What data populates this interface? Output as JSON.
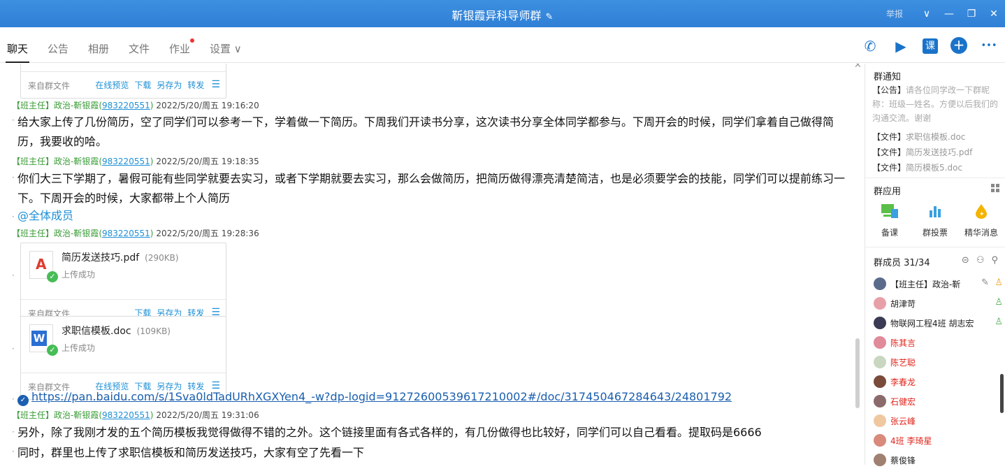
{
  "window": {
    "title": "靳银霞异科导师群",
    "report_label": "举报",
    "edit_glyph": "✎",
    "min_glyph": "—",
    "restore_glyph": "❐",
    "close_glyph": "✕",
    "chevron_glyph": "∨"
  },
  "tabs": [
    "聊天",
    "公告",
    "相册",
    "文件",
    "作业",
    "设置 ∨"
  ],
  "toolbar": {
    "call": "✆",
    "video": "▶",
    "lesson": "课",
    "add": "+",
    "more": "•••"
  },
  "chat": {
    "card0": {
      "source": "来自群文件",
      "preview": "在线预览",
      "download": "下载",
      "save_as": "另存为",
      "forward": "转发"
    },
    "msg1": {
      "role": "【班主任】政治-靳银霞(",
      "qq": "983220551",
      "close": ")",
      "time": "2022/5/20/周五 19:16:20",
      "text": "给大家上传了几份简历，空了同学们可以参考一下，学着做一下简历。下周我们开读书分享，这次读书分享全体同学都参与。下周开会的时候，同学们拿着自己做得简历，我要收的哈。"
    },
    "msg2": {
      "role": "【班主任】政治-靳银霞(",
      "qq": "983220551",
      "close": ")",
      "time": "2022/5/20/周五 19:18:35",
      "text": "你们大三下学期了，暑假可能有些同学就要去实习，或者下学期就要去实习，那么会做简历，把简历做得漂亮清楚简洁，也是必须要学会的技能，同学们可以提前练习一下。下周开会的时候，大家都带上个人简历",
      "mention": "@全体成员"
    },
    "msg3": {
      "role": "【班主任】政治-靳银霞(",
      "qq": "983220551",
      "close": ")",
      "time": "2022/5/20/周五 19:28:36"
    },
    "file1": {
      "name": "简历发送技巧.pdf",
      "size": "(290KB)",
      "status": "上传成功",
      "source": "来自群文件",
      "download": "下载",
      "save_as": "另存为",
      "forward": "转发"
    },
    "file2": {
      "name": "求职信模板.doc",
      "size": "(109KB)",
      "status": "上传成功",
      "source": "来自群文件",
      "preview": "在线预览",
      "download": "下载",
      "save_as": "另存为",
      "forward": "转发"
    },
    "link": "https://pan.baidu.com/s/1Sva0ldTadURhXGXYen4_-w?dp-logid=91272600539617210002#/doc/317450467284643/24801792",
    "msg4": {
      "role": "【班主任】政治-靳银霞(",
      "qq": "983220551",
      "close": ")",
      "time": "2022/5/20/周五 19:31:06",
      "text1": "另外，除了我刚才发的五个简历模板我觉得做得不错的之外。这个链接里面有各式各样的，有几份做得也比较好，同学们可以自己看看。提取码是6666",
      "text2": "同时，群里也上传了求职信模板和简历发送技巧，大家有空了先看一下"
    }
  },
  "sidebar": {
    "notice_title": "群通知",
    "notice_tag": "【公告】",
    "notice_text": "请各位同学改一下群昵称：班级—姓名。方便以后我们的沟通交流。谢谢",
    "files": [
      {
        "tag": "【文件】",
        "name": "求职信模板.doc"
      },
      {
        "tag": "【文件】",
        "name": "简历发送技巧.pdf"
      },
      {
        "tag": "【文件】",
        "name": "简历模板5.doc"
      }
    ],
    "apps_title": "群应用",
    "apps": [
      "备课",
      "群投票",
      "精华消息"
    ],
    "members_title": "群成员 31/34",
    "members": [
      {
        "name": "【班主任】政治-靳",
        "red": false,
        "color": "#5b6b8a"
      },
      {
        "name": "胡津苛",
        "red": false,
        "color": "#e8a0a8"
      },
      {
        "name": "物联网工程4班 胡志宏",
        "red": false,
        "color": "#3b3b55"
      },
      {
        "name": "陈其言",
        "red": true,
        "color": "#e08a9a"
      },
      {
        "name": "陈艺聪",
        "red": true,
        "color": "#c9d7c0"
      },
      {
        "name": "李春龙",
        "red": true,
        "color": "#7a4b3a"
      },
      {
        "name": "石健宏",
        "red": true,
        "color": "#8a6a6a"
      },
      {
        "name": "张云峰",
        "red": true,
        "color": "#f0c8a0"
      },
      {
        "name": "4班 李琦星",
        "red": true,
        "color": "#d98a7a"
      },
      {
        "name": "蔡俊锋",
        "red": false,
        "color": "#a08070"
      }
    ]
  }
}
